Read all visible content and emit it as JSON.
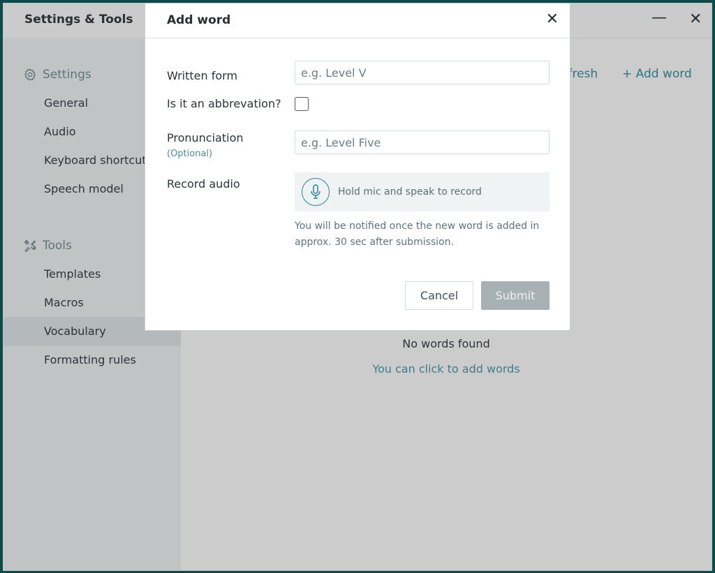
{
  "window": {
    "title": "Settings & Tools",
    "minimize_icon": "minimize-icon",
    "close_icon": "close-icon"
  },
  "sidebar": {
    "sections": [
      {
        "label": "Settings",
        "icon": "gear-icon",
        "items": [
          "General",
          "Audio",
          "Keyboard shortcuts",
          "Speech model"
        ]
      },
      {
        "label": "Tools",
        "icon": "tools-icon",
        "items": [
          "Templates",
          "Macros",
          "Vocabulary",
          "Formatting rules"
        ]
      }
    ],
    "active": "Vocabulary"
  },
  "main": {
    "refresh_label": "Refresh",
    "add_word_label": "+ Add word",
    "empty_title": "No words found",
    "empty_hint": "You can click to add words"
  },
  "dialog": {
    "title": "Add word",
    "written_form_label": "Written form",
    "written_form_placeholder": "e.g. Level V",
    "written_form_value": "",
    "abbreviation_label": "Is it an abbrevation?",
    "abbreviation_checked": false,
    "pronunciation_label": "Pronunciation",
    "pronunciation_optional": "(Optional)",
    "pronunciation_placeholder": "e.g. Level Five",
    "pronunciation_value": "",
    "record_label": "Record audio",
    "record_hint": "Hold mic and speak to record",
    "note": "You will be notified once the new word is added in approx. 30 sec after submission.",
    "cancel_label": "Cancel",
    "submit_label": "Submit"
  },
  "colors": {
    "accent": "#2f7482",
    "submit_disabled": "#a7b0b3"
  }
}
